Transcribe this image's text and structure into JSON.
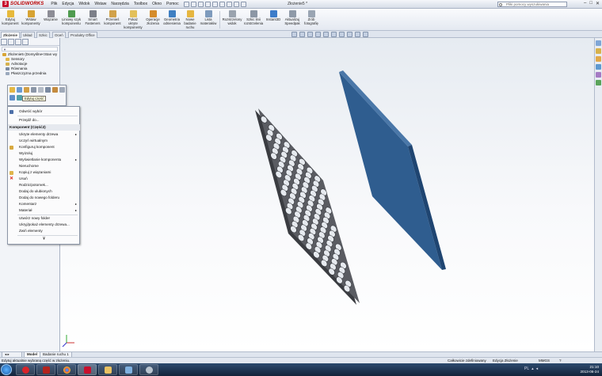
{
  "app": {
    "brand": "SOLIDWORKS",
    "menus": [
      "Plik",
      "Edycja",
      "Widok",
      "Wstaw",
      "Narzędzia",
      "Toolbox",
      "Okno",
      "Pomoc"
    ],
    "document_title": "Złożenie5 *",
    "search_placeholder": "Pliki pomocy wyszukiwania"
  },
  "commands": [
    {
      "label": "Edytuj komponent",
      "color": "#e7b93b"
    },
    {
      "label": "Wstaw komponenty",
      "color": "#d7a333"
    },
    {
      "label": "Wiązanie",
      "color": "#8d8d96"
    },
    {
      "label": "Liniowy szyk komponentu",
      "color": "#4f9b4f"
    },
    {
      "label": "Smart Fasteners",
      "color": "#7c7f88"
    },
    {
      "label": "Przenieś komponent",
      "color": "#d1a24a"
    },
    {
      "label": "Pokaż ukryte komponenty",
      "color": "#e3c05a"
    },
    {
      "label": "Operacje złożenia",
      "color": "#d58c2b"
    },
    {
      "label": "Geometria odniesienia",
      "color": "#3f7fc2"
    },
    {
      "label": "Nowe badanie ruchu",
      "color": "#e6b640"
    },
    {
      "label": "Lista materiałów",
      "color": "#7e9bbd"
    },
    {
      "label": "Rozstrzelony widok",
      "color": "#9aa3ae"
    },
    {
      "label": "Szkic linii rozstrzelenia",
      "color": "#8c97a5"
    },
    {
      "label": "Instant3D",
      "color": "#3c7cc9"
    },
    {
      "label": "Aktualizuj Speedpak",
      "color": "#8f9aa8"
    },
    {
      "label": "Zrób fotografię",
      "color": "#9aa5b3"
    }
  ],
  "tabs": [
    "Złożenie",
    "Układ",
    "Szkic",
    "Oceń",
    "Produkty Office"
  ],
  "tree": {
    "root": "Złożenie5  (Domyślne<Stan wy",
    "items": [
      "Sensory",
      "Adnotacje",
      "Równania",
      "Płaszczyzna przednia"
    ]
  },
  "context_toolbar_tooltip": "Edytuj część",
  "context_menu": {
    "items_top": [
      "Odwróć wybór",
      "Przejdź do..."
    ],
    "header": "Komponent (Część2)",
    "items_component": [
      {
        "label": "Ukryte elementy drzewa",
        "submenu": true
      },
      {
        "label": "Uczyń wirtualnym",
        "submenu": false
      },
      {
        "label": "Konfiguruj komponent",
        "submenu": false
      },
      {
        "label": "Wyizoluj",
        "submenu": false
      },
      {
        "label": "Wyświetlanie komponentu",
        "submenu": true
      },
      {
        "label": "Nieruchome",
        "submenu": false
      },
      {
        "label": "Kopiuj z wiązaniami",
        "submenu": false
      },
      {
        "label": "Usuń",
        "submenu": false
      },
      {
        "label": "Rodzic/potomek...",
        "submenu": false
      },
      {
        "label": "Dodaj do ulubionych",
        "submenu": false
      },
      {
        "label": "Dodaj do nowego folderu",
        "submenu": false
      },
      {
        "label": "Komentarz",
        "submenu": true
      },
      {
        "label": "Materiał",
        "submenu": true
      }
    ],
    "items_bottom": [
      "Utwórz nowy folder",
      "Ukryj/pokaż elementy drzewa...",
      "Zwiń elementy"
    ],
    "more": "¥"
  },
  "bottom_tabs": [
    "Model",
    "Badanie ruchu 1"
  ],
  "status": {
    "left": "Edytuj aktualnie wybraną część w złożeniu.",
    "defined": "Całkowicie zdefiniowany",
    "mode": "Edycja Złożenie",
    "units": "MMGS"
  },
  "taskbar": {
    "lang": "PL",
    "time": "21:10",
    "date": "2013-06-24"
  },
  "colors": {
    "plate_gray": "#5a5c62",
    "plate_blue": "#2f5d8f"
  }
}
